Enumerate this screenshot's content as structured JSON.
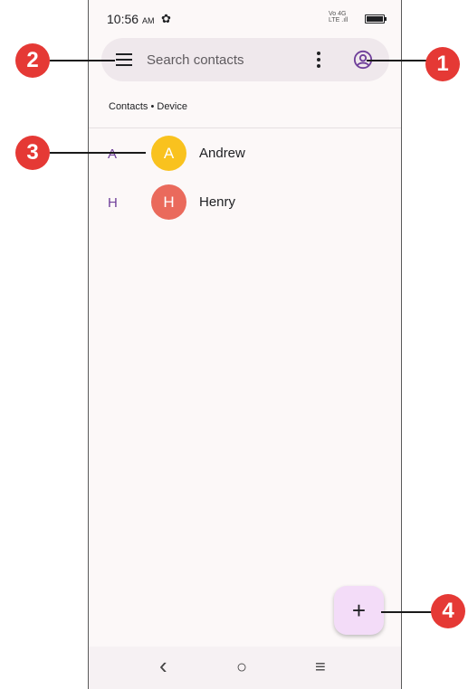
{
  "status_bar": {
    "time": "10:56",
    "ampm": "AM",
    "network_top": "Vo",
    "network_bottom": "LTE",
    "network_4g": "4G"
  },
  "search": {
    "placeholder": "Search contacts"
  },
  "section_label": "Contacts • Device",
  "contacts": [
    {
      "index": "A",
      "initial": "A",
      "name": "Andrew",
      "color": "#f9c21e"
    },
    {
      "index": "H",
      "initial": "H",
      "name": "Henry",
      "color": "#ea6a5c"
    }
  ],
  "fab": {
    "label": "+"
  },
  "nav": {
    "back": "‹",
    "home": "○",
    "recents": "≡"
  },
  "callouts": [
    "1",
    "2",
    "3",
    "4"
  ],
  "colors": {
    "callout": "#e53935",
    "accent": "#6f3f9a",
    "fab_bg": "#f3dcf8"
  }
}
